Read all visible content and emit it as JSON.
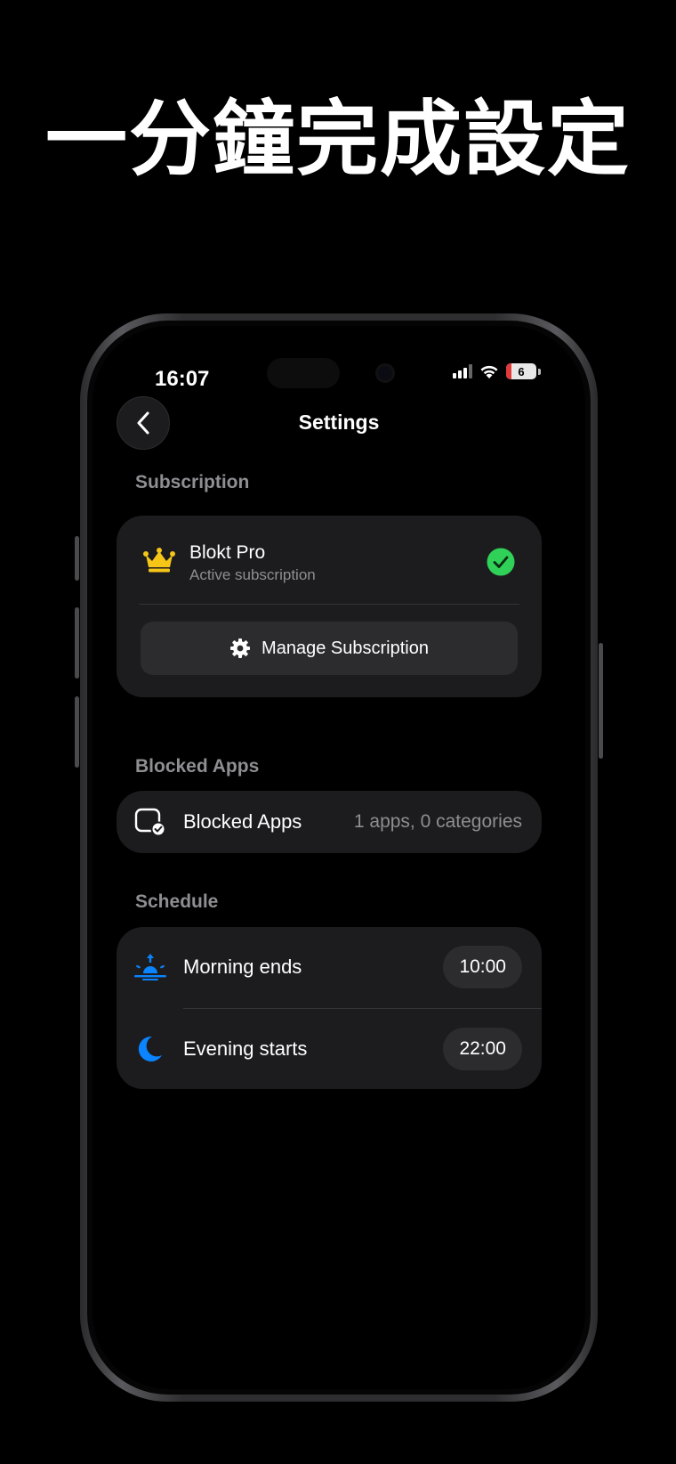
{
  "promo": {
    "headline": "一分鐘完成設定"
  },
  "status_bar": {
    "time": "16:07",
    "battery": "6",
    "signal_icon": "cellular-signal-icon",
    "wifi_icon": "wifi-icon"
  },
  "nav": {
    "title": "Settings",
    "back_icon": "chevron-left-icon"
  },
  "subscription": {
    "section_label": "Subscription",
    "plan_name": "Blokt Pro",
    "plan_status": "Active subscription",
    "manage_label": "Manage Subscription",
    "crown_icon": "crown-icon",
    "status_icon": "checkmark-circle-icon",
    "accent": "#f5c518",
    "check_color": "#30d158"
  },
  "blocked_apps": {
    "section_label": "Blocked Apps",
    "row_label": "Blocked Apps",
    "summary": "1 apps, 0 categories",
    "icon": "blocked-app-check-icon"
  },
  "schedule": {
    "section_label": "Schedule",
    "items": [
      {
        "label": "Morning ends",
        "time": "10:00",
        "icon": "sunrise-icon"
      },
      {
        "label": "Evening starts",
        "time": "22:00",
        "icon": "moon-icon"
      }
    ],
    "icon_color": "#0a84ff"
  }
}
